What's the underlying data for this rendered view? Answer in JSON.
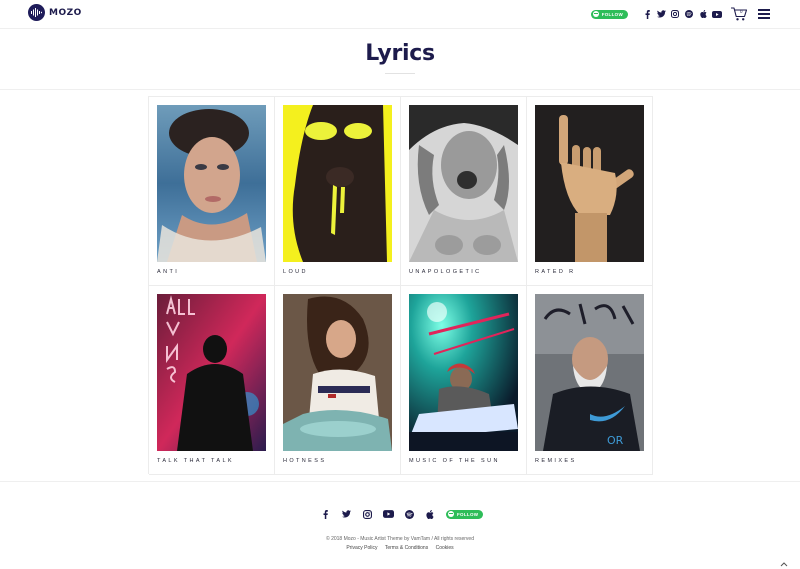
{
  "brand": {
    "name": "MOZO"
  },
  "header": {
    "follow_label": "FOLLOW",
    "cart_count": "0"
  },
  "page": {
    "title": "Lyrics"
  },
  "albums": [
    {
      "title": "ANTI"
    },
    {
      "title": "LOUD"
    },
    {
      "title": "UNAPOLOGETIC"
    },
    {
      "title": "RATED R"
    },
    {
      "title": "TALK THAT TALK"
    },
    {
      "title": "HOTNESS"
    },
    {
      "title": "MUSIC OF THE SUN"
    },
    {
      "title": "REMIXES"
    }
  ],
  "footer": {
    "follow_label": "FOLLOW",
    "copyright": "© 2018 Mozo - Music Artist Theme by VamTam / All rights reserved",
    "links": [
      "Privacy Policy",
      "Terms & Conditions",
      "Cookies"
    ]
  },
  "colors": {
    "brand": "#1d1b4c",
    "spotify_green": "#2ebd59"
  },
  "icons": [
    "facebook-icon",
    "twitter-icon",
    "instagram-icon",
    "spotify-icon",
    "apple-icon",
    "youtube-icon",
    "cart-icon",
    "menu-icon",
    "chevron-up-icon"
  ]
}
